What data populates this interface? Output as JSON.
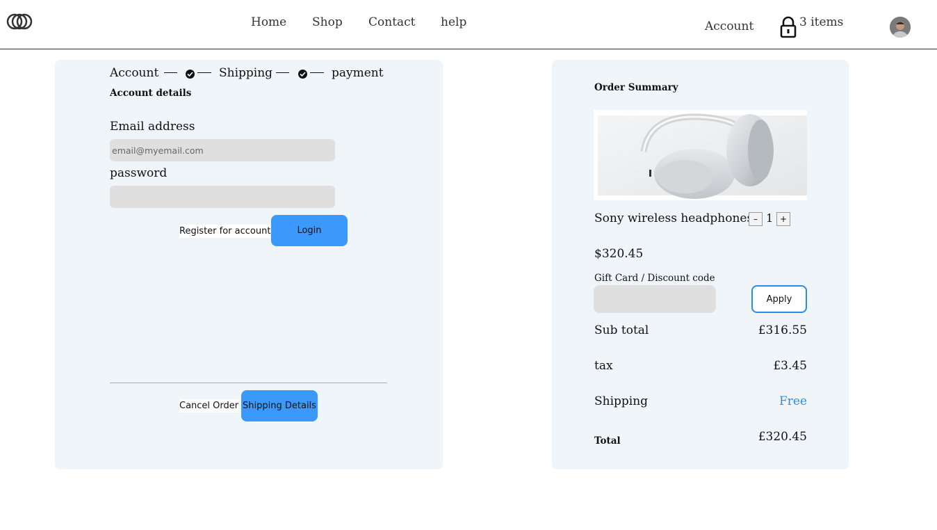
{
  "header": {
    "nav": [
      "Home",
      "Shop",
      "Contact",
      "help"
    ],
    "account_label": "Account",
    "cart_label": "3 items"
  },
  "checkout": {
    "steps": [
      "Account",
      "Shipping",
      "payment"
    ],
    "section_title": "Account details",
    "email_label": "Email address",
    "email_placeholder": "email@myemail.com",
    "email_value": "",
    "password_label": "password",
    "password_value": "",
    "register_label": "Register for account",
    "login_label": "Login",
    "cancel_label": "Cancel Order",
    "next_label": "Shipping Details"
  },
  "summary": {
    "title": "Order Summary",
    "product_name": "Sony wireless headphones",
    "quantity": "1",
    "qty_minus": "–",
    "qty_plus": "+",
    "price": "$320.45",
    "discount_label": "Gift Card / Discount code",
    "discount_value": "",
    "apply_label": "Apply",
    "subtotal_label": "Sub total",
    "subtotal_value": "£316.55",
    "tax_label": "tax",
    "tax_value": "£3.45",
    "shipping_label": "Shipping",
    "shipping_value": "Free",
    "total_label": "Total",
    "total_value": "£320.45"
  },
  "colors": {
    "accent": "#3b99fc",
    "panel_bg": "#f0f5f9",
    "free_text": "#2d8ae6",
    "input_bg": "#e0dfe0"
  }
}
